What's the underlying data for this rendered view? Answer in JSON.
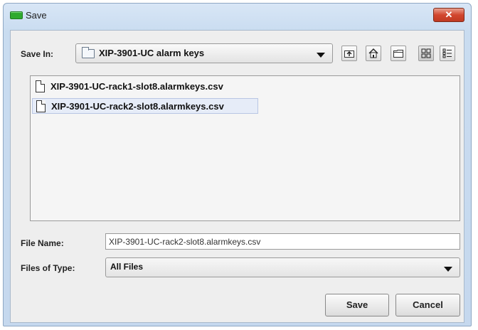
{
  "window": {
    "title": "Save",
    "close_label": "✕"
  },
  "save_in": {
    "label": "Save In:",
    "value": "XIP-3901-UC alarm keys"
  },
  "toolbar_icons": [
    "up-one-level-icon",
    "home-icon",
    "new-folder-icon",
    "list-view-icon",
    "details-view-icon"
  ],
  "files": [
    {
      "name": "XIP-3901-UC-rack1-slot8.alarmkeys.csv",
      "selected": false
    },
    {
      "name": "XIP-3901-UC-rack2-slot8.alarmkeys.csv",
      "selected": true
    }
  ],
  "file_name": {
    "label": "File Name:",
    "value": "XIP-3901-UC-rack2-slot8.alarmkeys.csv"
  },
  "file_type": {
    "label": "Files of Type:",
    "value": "All Files"
  },
  "buttons": {
    "save": "Save",
    "cancel": "Cancel"
  },
  "colors": {
    "title_bar": "#c9dcf0",
    "close_button": "#d2472f",
    "selection": "#e6ecf8"
  }
}
